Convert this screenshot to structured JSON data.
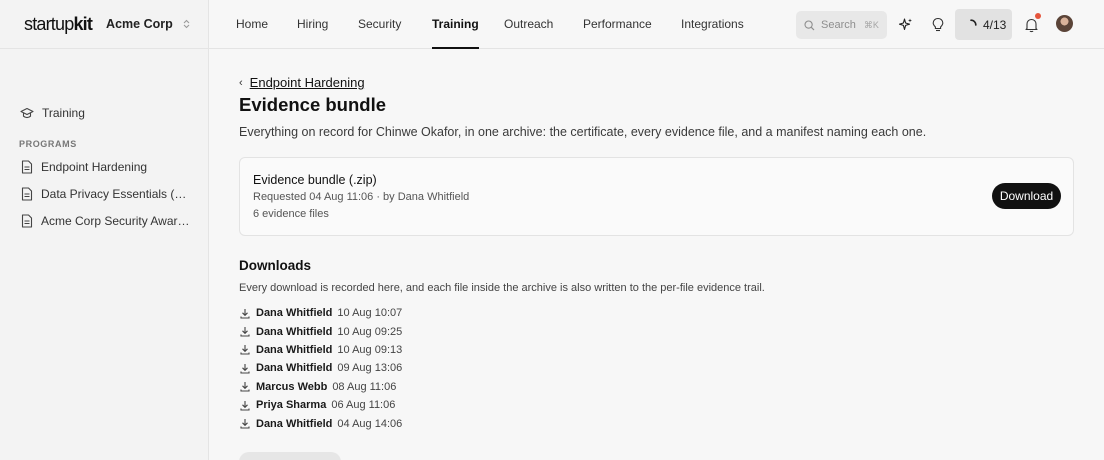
{
  "brand": {
    "logo_light": "startup",
    "logo_bold": "kit",
    "org": "Acme Corp"
  },
  "sidebar": {
    "top_item": "Training",
    "section_label": "PROGRAMS",
    "items": [
      {
        "label": "Endpoint Hardening"
      },
      {
        "label": "Data Privacy Essentials (GDPR)"
      },
      {
        "label": "Acme Corp Security Awareness"
      }
    ]
  },
  "nav": {
    "tabs": [
      {
        "label": "Home"
      },
      {
        "label": "Hiring"
      },
      {
        "label": "Security"
      },
      {
        "label": "Training"
      },
      {
        "label": "Outreach"
      },
      {
        "label": "Performance"
      },
      {
        "label": "Integrations"
      }
    ],
    "active_tab": "Training",
    "search_placeholder": "Search",
    "search_shortcut": "⌘K",
    "progress": "4/13",
    "has_notification": true
  },
  "page": {
    "breadcrumb": "Endpoint Hardening",
    "title": "Evidence bundle",
    "description": "Everything on record for Chinwe Okafor, in one archive: the certificate, every evidence file, and a manifest naming each one."
  },
  "bundle": {
    "title": "Evidence bundle (.zip)",
    "requested": "Requested 04 Aug 11:06 · by Dana Whitfield",
    "files": "6 evidence files",
    "download_label": "Download"
  },
  "downloads": {
    "title": "Downloads",
    "description": "Every download is recorded here, and each file inside the archive is also written to the per-file evidence trail.",
    "rows": [
      {
        "name": "Dana Whitfield",
        "time": "10 Aug 10:07"
      },
      {
        "name": "Dana Whitfield",
        "time": "10 Aug 09:25"
      },
      {
        "name": "Dana Whitfield",
        "time": "10 Aug 09:13"
      },
      {
        "name": "Dana Whitfield",
        "time": "09 Aug 13:06"
      },
      {
        "name": "Marcus Webb",
        "time": "08 Aug 11:06"
      },
      {
        "name": "Priya Sharma",
        "time": "06 Aug 11:06"
      },
      {
        "name": "Dana Whitfield",
        "time": "04 Aug 14:06"
      }
    ]
  },
  "colors": {
    "accent": "#111111",
    "notification": "#e5553c",
    "background": "#f7f7f7"
  }
}
